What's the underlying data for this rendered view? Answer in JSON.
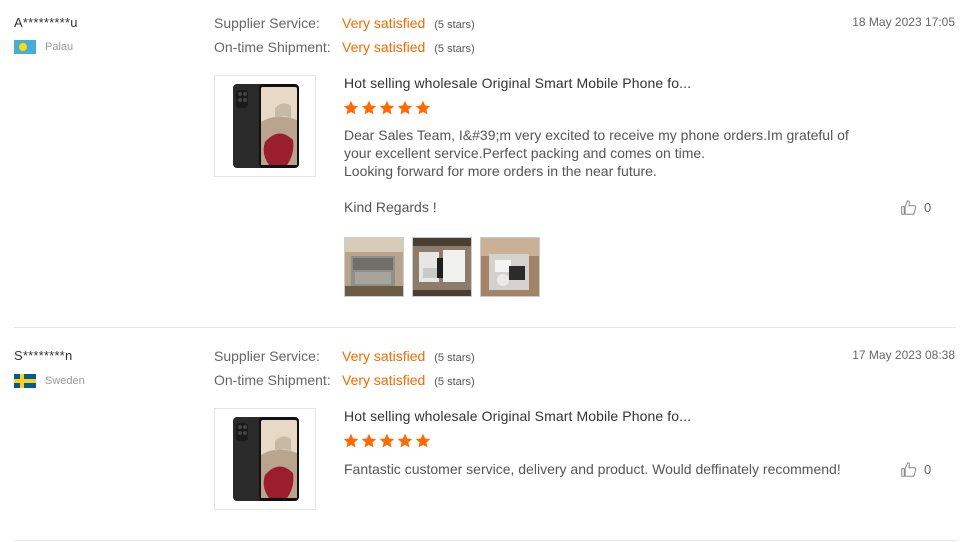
{
  "reviews": [
    {
      "buyer_name": "A*********u",
      "country": "Palau",
      "supplier_service_label": "Supplier Service:",
      "supplier_service_value": "Very satisfied",
      "supplier_service_stars": "(5 stars)",
      "shipment_label": "On-time Shipment:",
      "shipment_value": "Very satisfied",
      "shipment_stars": "(5 stars)",
      "date": "18 May 2023 17:05",
      "product_title": "Hot selling wholesale Original Smart Mobile Phone fo...",
      "rating": 5,
      "text_lines": [
        "Dear Sales Team, I&#39;m very excited to receive my phone orders.Im grateful of",
        "your excellent service.Perfect packing and comes on time.",
        "Looking forward for more orders in the near future.",
        "Kind Regards !"
      ],
      "helpful_count": "0",
      "photo_count": 3
    },
    {
      "buyer_name": "S********n",
      "country": "Sweden",
      "supplier_service_label": "Supplier Service:",
      "supplier_service_value": "Very satisfied",
      "supplier_service_stars": "(5 stars)",
      "shipment_label": "On-time Shipment:",
      "shipment_value": "Very satisfied",
      "shipment_stars": "(5 stars)",
      "date": "17 May 2023 08:38",
      "product_title": "Hot selling wholesale Original Smart Mobile Phone fo...",
      "rating": 5,
      "text_lines": [
        "Fantastic customer service, delivery and product. Would deffinately recommend!"
      ],
      "helpful_count": "0"
    }
  ],
  "colors": {
    "accent": "#f56a00",
    "star": "#ff6a00",
    "divider": "#e6e6e6"
  },
  "icons": {
    "flag_1": "palau-flag-icon",
    "flag_2": "sweden-flag-icon",
    "helpful": "thumb-up-icon",
    "star": "star-icon"
  }
}
